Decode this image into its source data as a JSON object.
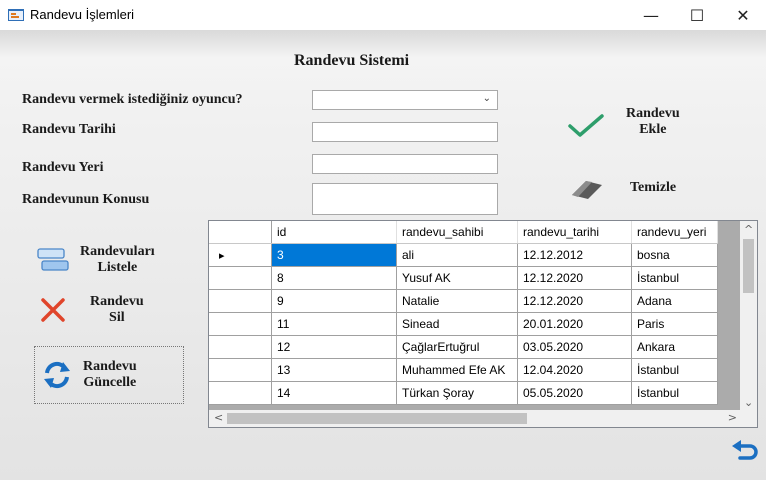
{
  "window": {
    "title": "Randevu İşlemleri",
    "minimize": "—",
    "maximize": "☐",
    "close": "✕"
  },
  "form": {
    "heading": "Randevu Sistemi",
    "labels": {
      "player": "Randevu vermek istediğiniz oyuncu?",
      "date": "Randevu Tarihi",
      "place": "Randevu Yeri",
      "subject": "Randevunun Konusu"
    },
    "combo_arrow": "⌄"
  },
  "actions": {
    "add": {
      "line1": "Randevu",
      "line2": "Ekle",
      "icon": "checkmark-icon"
    },
    "clear": {
      "label": "Temizle",
      "icon": "eraser-icon"
    },
    "list": {
      "line1": "Randevuları",
      "line2": "Listele",
      "icon": "list-icon"
    },
    "delete": {
      "line1": "Randevu",
      "line2": "Sil",
      "icon": "x-icon"
    },
    "update": {
      "line1": "Randevu",
      "line2": "Güncelle",
      "icon": "refresh-icon"
    },
    "back": {
      "icon": "back-arrow-icon"
    }
  },
  "grid": {
    "columns": [
      "id",
      "randevu_sahibi",
      "randevu_tarihi",
      "randevu_yeri"
    ],
    "current_row_marker": "▸",
    "rows": [
      [
        "3",
        "ali",
        "12.12.2012",
        "bosna"
      ],
      [
        "8",
        "Yusuf AK",
        "12.12.2020",
        "İstanbul"
      ],
      [
        "9",
        "Natalie",
        "12.12.2020",
        "Adana"
      ],
      [
        "11",
        "Sinead",
        "20.01.2020",
        "Paris"
      ],
      [
        "12",
        "ÇağlarErtuğrul",
        "03.05.2020",
        "Ankara"
      ],
      [
        "13",
        "Muhammed Efe AK",
        "12.04.2020",
        "İstanbul"
      ],
      [
        "14",
        "Türkan Şoray",
        "05.05.2020",
        "İstanbul"
      ]
    ],
    "scroll": {
      "up": "^",
      "down": "⌄",
      "left": "<",
      "right": ">"
    }
  },
  "colors": {
    "selection": "#0078d7",
    "check": "#2e9e6b",
    "delete": "#e0452b",
    "refresh": "#1b6fc2"
  }
}
